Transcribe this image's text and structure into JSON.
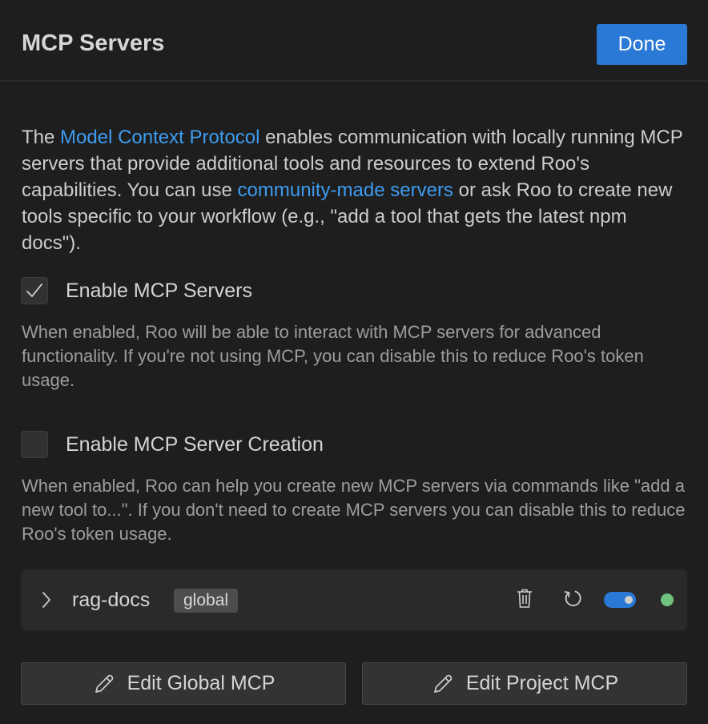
{
  "header": {
    "title": "MCP Servers",
    "done_label": "Done"
  },
  "intro": {
    "text_1": "The ",
    "link_protocol": "Model Context Protocol",
    "text_2": " enables communication with locally running MCP servers that provide additional tools and resources to extend Roo's capabilities. You can use ",
    "link_community": "community-made servers",
    "text_3": " or ask Roo to create new tools specific to your workflow (e.g., \"add a tool that gets the latest npm docs\")."
  },
  "settings": {
    "enable_servers": {
      "label": "Enable MCP Servers",
      "checked": true,
      "description": "When enabled, Roo will be able to interact with MCP servers for advanced functionality. If you're not using MCP, you can disable this to reduce Roo's token usage."
    },
    "enable_creation": {
      "label": "Enable MCP Server Creation",
      "checked": false,
      "description": "When enabled, Roo can help you create new MCP servers via commands like \"add a new tool to...\". If you don't need to create MCP servers you can disable this to reduce Roo's token usage."
    }
  },
  "servers": [
    {
      "name": "rag-docs",
      "scope": "global",
      "enabled": true,
      "status_color": "#6fc37f"
    }
  ],
  "actions": {
    "edit_global": "Edit Global MCP",
    "edit_project": "Edit Project MCP"
  },
  "colors": {
    "accent": "#2b79d6",
    "link": "#3d9cf0",
    "status_connected": "#6fc37f"
  }
}
